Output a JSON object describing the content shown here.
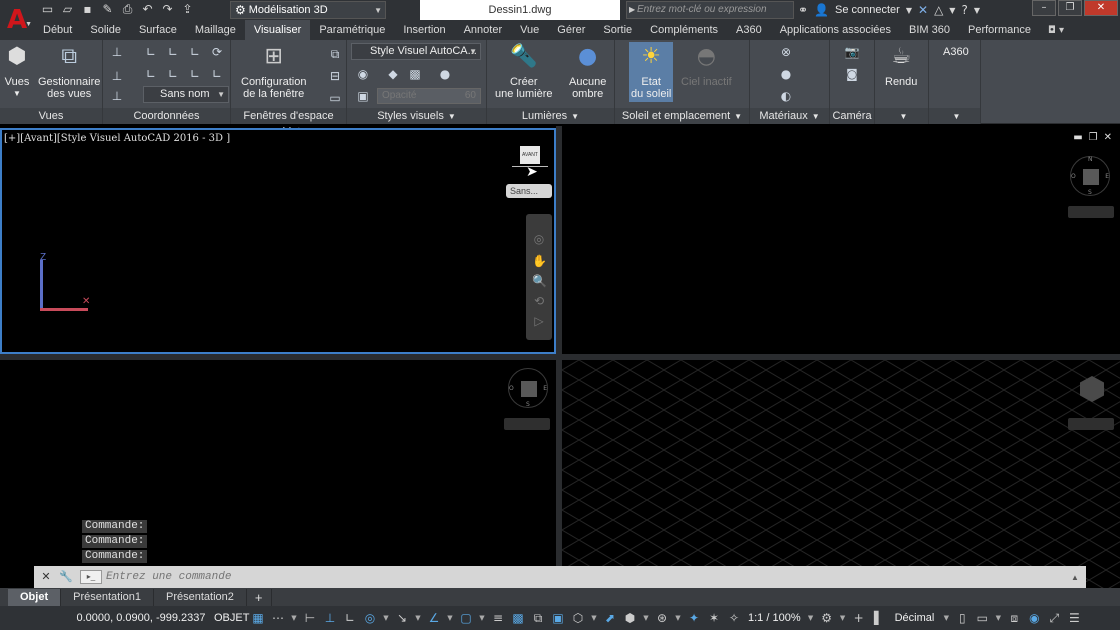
{
  "titlebar": {
    "workspace": "Modélisation 3D",
    "doc_title": "Dessin1.dwg",
    "search_placeholder": "Entrez mot-clé ou expression",
    "sign_in": "Se connecter"
  },
  "tabs": [
    "Début",
    "Solide",
    "Surface",
    "Maillage",
    "Visualiser",
    "Paramétrique",
    "Insertion",
    "Annoter",
    "Vue",
    "Gérer",
    "Sortie",
    "Compléments",
    "A360",
    "Applications associées",
    "BIM 360",
    "Performance"
  ],
  "active_tab": "Visualiser",
  "ribbon": {
    "vues": {
      "vues_btn": "Vues",
      "gestionnaire_l1": "Gestionnaire",
      "gestionnaire_l2": "des vues",
      "footer": "Vues"
    },
    "coordonnees": {
      "combo": "Sans nom",
      "footer": "Coordonnées"
    },
    "fenetres": {
      "config_l1": "Configuration",
      "config_l2": "de la fenêtre",
      "footer": "Fenêtres d'espace objet"
    },
    "styles": {
      "combo": "Style Visuel AutoCA...",
      "opacity_label": "Opacité",
      "opacity_value": "60",
      "footer": "Styles visuels"
    },
    "lumieres": {
      "creer_l1": "Créer",
      "creer_l2": "une lumière",
      "aucune_l1": "Aucune",
      "aucune_l2": "ombre",
      "footer": "Lumières"
    },
    "soleil": {
      "etat_l1": "Etat",
      "etat_l2": "du soleil",
      "ciel": "Ciel inactif",
      "footer": "Soleil et emplacement"
    },
    "materiaux": {
      "footer": "Matériaux"
    },
    "camera": {
      "footer": "Caméra"
    },
    "rendu": {
      "label": "Rendu"
    },
    "a360": {
      "label": "A360"
    }
  },
  "viewports": {
    "top_left_label": "[+][Avant][Style Visuel AutoCAD 2016 - 3D ]",
    "top_left_wcs": "Sans...",
    "ucs_axis_z": "Z",
    "front_face": "AVANT",
    "compass": {
      "n": "N",
      "s": "S",
      "e": "E",
      "o": "O"
    }
  },
  "command": {
    "history": [
      "Commande:",
      "Commande:",
      "Commande:"
    ],
    "placeholder": "Entrez une commande"
  },
  "layout_tabs": [
    "Objet",
    "Présentation1",
    "Présentation2"
  ],
  "statusbar": {
    "coords": "0.0000, 0.0900, -999.2337",
    "model": "OBJET",
    "scale": "1:1 / 100%",
    "units": "Décimal"
  }
}
